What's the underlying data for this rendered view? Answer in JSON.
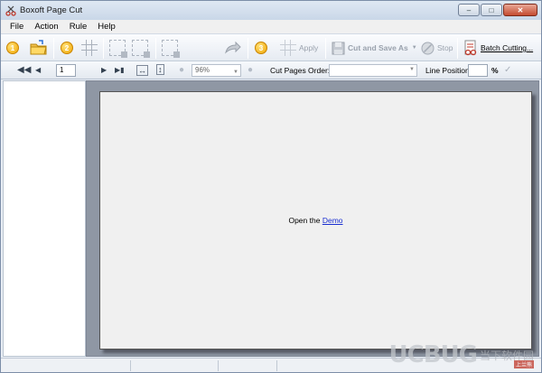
{
  "window": {
    "title": "Boxoft Page Cut"
  },
  "menu": [
    "File",
    "Action",
    "Rule",
    "Help"
  ],
  "toolbar": {
    "step1": "1",
    "step2": "2",
    "step3": "3",
    "apply_label": "Apply",
    "cut_save_label": "Cut and Save As",
    "stop_label": "Stop",
    "batch_label": "Batch Cutting..."
  },
  "navbar": {
    "page_number": "1",
    "zoom": "96%",
    "cut_order_label": "Cut Pages Order:",
    "line_position_label": "Line Position:",
    "percent": "%"
  },
  "viewer": {
    "open_text": "Open the",
    "demo_link": "Demo"
  },
  "watermark": {
    "logo": "UCBUG",
    "text": "当下软件园",
    "small": "上兰熊"
  }
}
